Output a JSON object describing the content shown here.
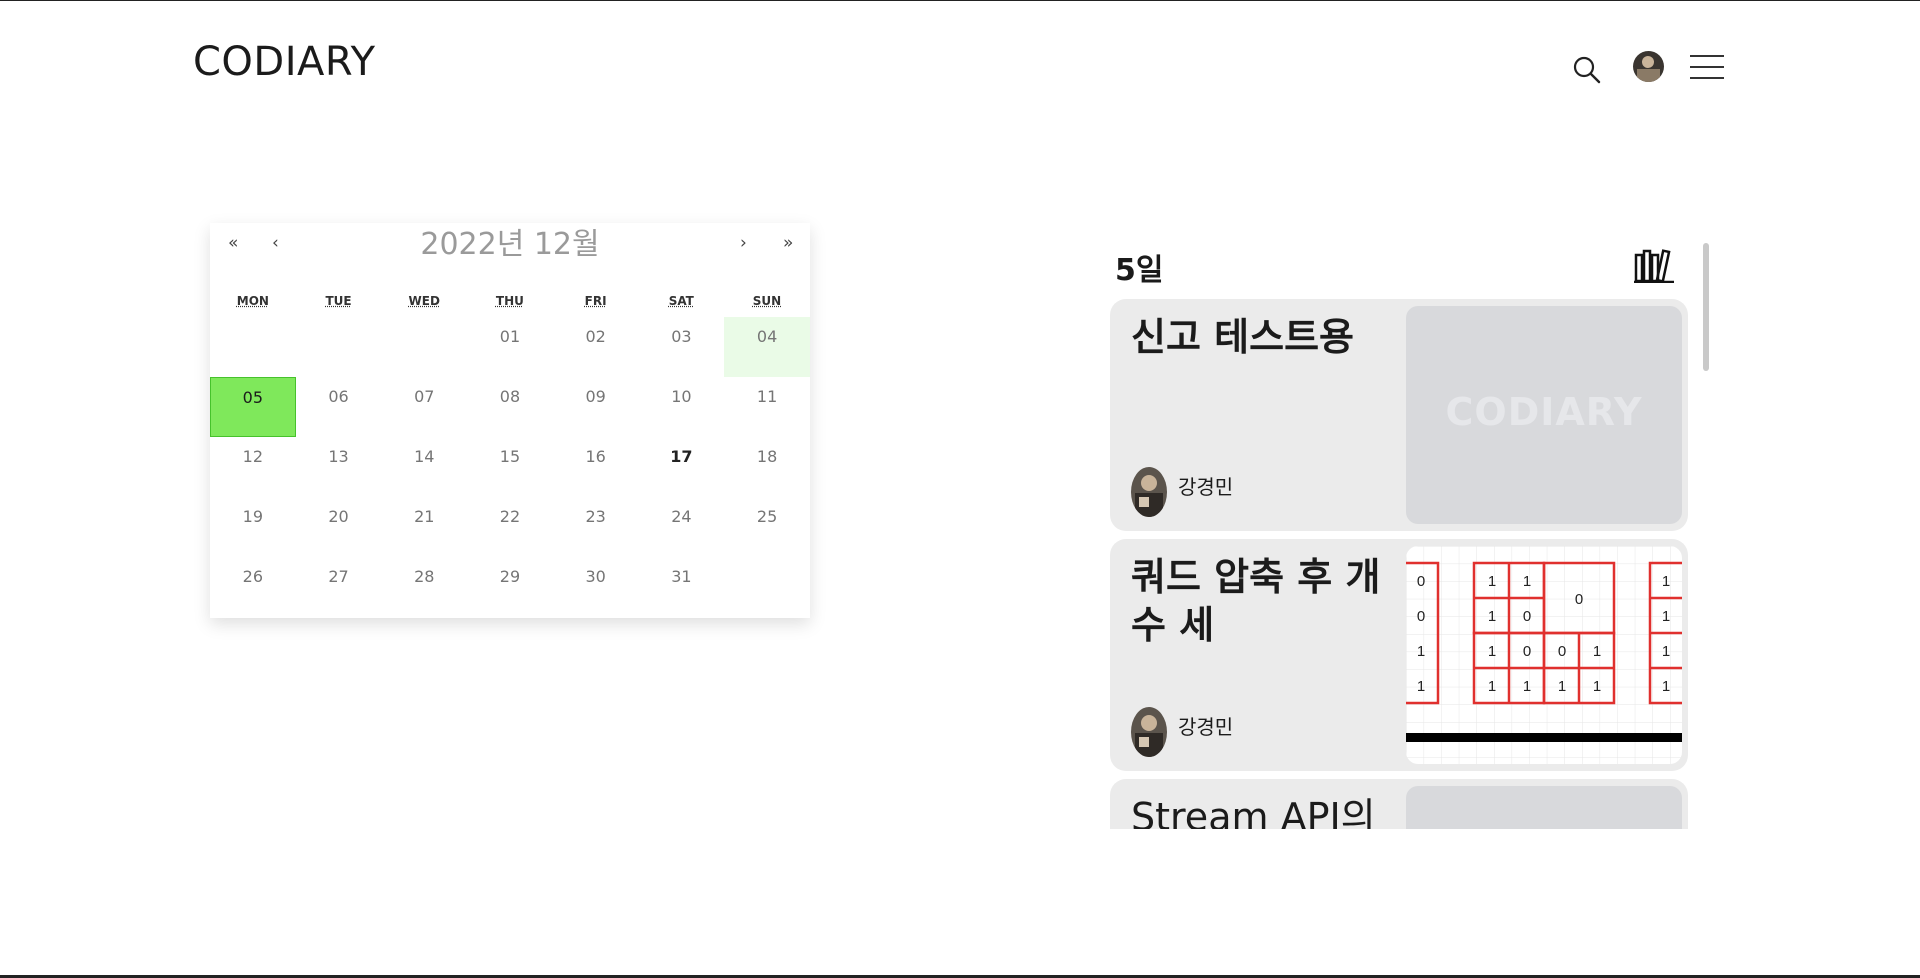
{
  "header": {
    "logo": "CODIARY",
    "icons": [
      "search-icon",
      "avatar",
      "menu-icon"
    ]
  },
  "calendar": {
    "title": "2022년 12월",
    "nav": {
      "prev_year": "«",
      "prev_month": "‹",
      "next_month": "›",
      "next_year": "»"
    },
    "weekdays": [
      "MON",
      "TUE",
      "WED",
      "THU",
      "FRI",
      "SAT",
      "SUN"
    ],
    "days": [
      "",
      "",
      "",
      "01",
      "02",
      "03",
      "04",
      "05",
      "06",
      "07",
      "08",
      "09",
      "10",
      "11",
      "12",
      "13",
      "14",
      "15",
      "16",
      "17",
      "18",
      "19",
      "20",
      "21",
      "22",
      "23",
      "24",
      "25",
      "26",
      "27",
      "28",
      "29",
      "30",
      "31",
      ""
    ],
    "selected_day": "05",
    "today": "17",
    "highlight_color": "#7fe85b"
  },
  "panel": {
    "day_label": "5일",
    "cards": [
      {
        "title": "신고 테스트용",
        "author": "강경민",
        "thumb_text": "CODIARY"
      },
      {
        "title": "쿼드 압축 후 개수 세",
        "author": "강경민",
        "thumb_text": ""
      },
      {
        "title": "Stream API의",
        "author": "",
        "thumb_text": ""
      }
    ]
  }
}
